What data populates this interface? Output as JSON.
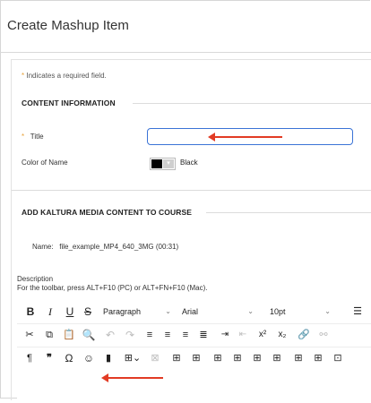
{
  "header": {
    "title": "Create Mashup Item"
  },
  "required_note": {
    "star": "*",
    "text": "Indicates a required field."
  },
  "content_info": {
    "heading": "CONTENT INFORMATION",
    "title_label": "Title",
    "title_value": "",
    "color_label": "Color of Name",
    "color_value": "Black",
    "color_hex": "#000000"
  },
  "kaltura": {
    "heading": "ADD KALTURA MEDIA CONTENT TO COURSE",
    "name_label": "Name:",
    "name_value": "file_example_MP4_640_3MG (00:31)",
    "description_label": "Description",
    "toolbar_hint": "For the toolbar, press ALT+F10 (PC) or ALT+FN+F10 (Mac)."
  },
  "toolbar": {
    "row1": {
      "bold": "B",
      "italic": "I",
      "underline": "U",
      "strike": "S",
      "paragraph": "Paragraph",
      "font": "Arial",
      "size": "10pt"
    },
    "icons": {
      "row1": [
        "bold-icon",
        "italic-icon",
        "underline-icon",
        "strikethrough-icon",
        "format-dropdown",
        "font-dropdown",
        "size-dropdown",
        "list-icon"
      ],
      "row2": [
        "cut-icon",
        "copy-icon",
        "paste-icon",
        "find-icon",
        "undo-icon",
        "redo-icon",
        "align-left-icon",
        "align-center-icon",
        "align-right-icon",
        "justify-icon",
        "indent-icon",
        "outdent-icon",
        "superscript-icon",
        "subscript-icon",
        "link-icon",
        "unlink-icon"
      ],
      "row3": [
        "paragraph-mark-icon",
        "blockquote-icon",
        "special-char-icon",
        "emoji-icon",
        "bookmark-icon",
        "table-icon",
        "table-props-icon",
        "table-grid-icon",
        "table-split-icon",
        "table-merge-icon",
        "row-before-icon",
        "row-after-icon",
        "col-before-icon",
        "col-after-icon",
        "col-delete-icon",
        "cell-props-icon"
      ]
    }
  },
  "accent_colors": {
    "arrow": "#e23b24",
    "focus": "#3a73d6",
    "required": "#e8a23a"
  }
}
